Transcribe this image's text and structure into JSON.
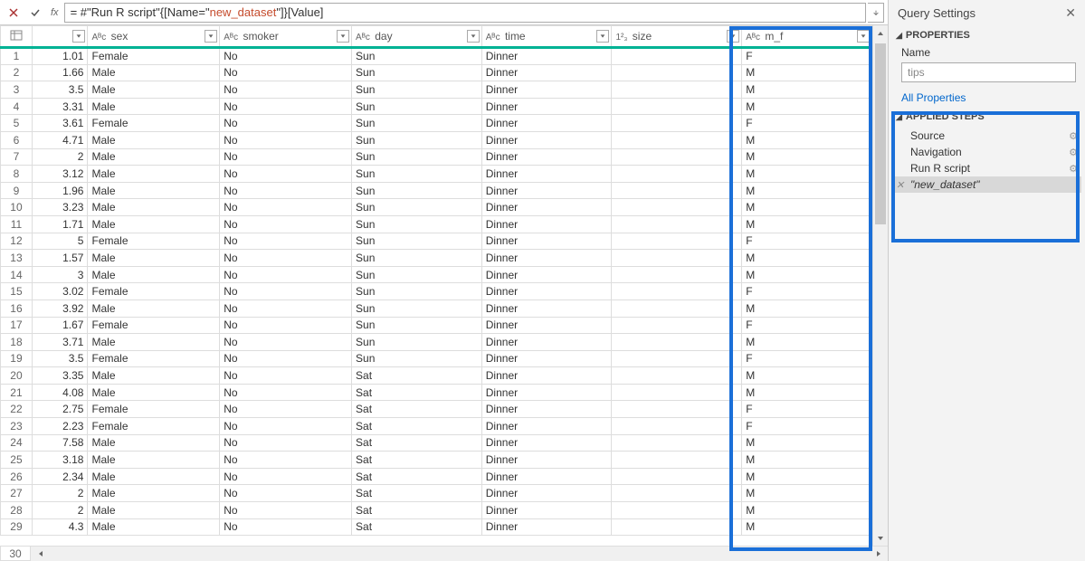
{
  "formula": {
    "prefix": "= #\"Run R script\"{[Name=\"",
    "highlight": "new_dataset",
    "suffix": "\"]}[Value]"
  },
  "columns": {
    "tip_type": "",
    "sex": "sex",
    "smoker": "smoker",
    "day": "day",
    "time": "time",
    "size": "size",
    "mf": "m_f"
  },
  "type_icons": {
    "abc": "Aᴮc",
    "num": "1²₃"
  },
  "rows": [
    {
      "n": "1",
      "tip": "1.01",
      "sex": "Female",
      "smoker": "No",
      "day": "Sun",
      "time": "Dinner",
      "size": "",
      "mf": "F"
    },
    {
      "n": "2",
      "tip": "1.66",
      "sex": "Male",
      "smoker": "No",
      "day": "Sun",
      "time": "Dinner",
      "size": "",
      "mf": "M"
    },
    {
      "n": "3",
      "tip": "3.5",
      "sex": "Male",
      "smoker": "No",
      "day": "Sun",
      "time": "Dinner",
      "size": "",
      "mf": "M"
    },
    {
      "n": "4",
      "tip": "3.31",
      "sex": "Male",
      "smoker": "No",
      "day": "Sun",
      "time": "Dinner",
      "size": "",
      "mf": "M"
    },
    {
      "n": "5",
      "tip": "3.61",
      "sex": "Female",
      "smoker": "No",
      "day": "Sun",
      "time": "Dinner",
      "size": "",
      "mf": "F"
    },
    {
      "n": "6",
      "tip": "4.71",
      "sex": "Male",
      "smoker": "No",
      "day": "Sun",
      "time": "Dinner",
      "size": "",
      "mf": "M"
    },
    {
      "n": "7",
      "tip": "2",
      "sex": "Male",
      "smoker": "No",
      "day": "Sun",
      "time": "Dinner",
      "size": "",
      "mf": "M"
    },
    {
      "n": "8",
      "tip": "3.12",
      "sex": "Male",
      "smoker": "No",
      "day": "Sun",
      "time": "Dinner",
      "size": "",
      "mf": "M"
    },
    {
      "n": "9",
      "tip": "1.96",
      "sex": "Male",
      "smoker": "No",
      "day": "Sun",
      "time": "Dinner",
      "size": "",
      "mf": "M"
    },
    {
      "n": "10",
      "tip": "3.23",
      "sex": "Male",
      "smoker": "No",
      "day": "Sun",
      "time": "Dinner",
      "size": "",
      "mf": "M"
    },
    {
      "n": "11",
      "tip": "1.71",
      "sex": "Male",
      "smoker": "No",
      "day": "Sun",
      "time": "Dinner",
      "size": "",
      "mf": "M"
    },
    {
      "n": "12",
      "tip": "5",
      "sex": "Female",
      "smoker": "No",
      "day": "Sun",
      "time": "Dinner",
      "size": "",
      "mf": "F"
    },
    {
      "n": "13",
      "tip": "1.57",
      "sex": "Male",
      "smoker": "No",
      "day": "Sun",
      "time": "Dinner",
      "size": "",
      "mf": "M"
    },
    {
      "n": "14",
      "tip": "3",
      "sex": "Male",
      "smoker": "No",
      "day": "Sun",
      "time": "Dinner",
      "size": "",
      "mf": "M"
    },
    {
      "n": "15",
      "tip": "3.02",
      "sex": "Female",
      "smoker": "No",
      "day": "Sun",
      "time": "Dinner",
      "size": "",
      "mf": "F"
    },
    {
      "n": "16",
      "tip": "3.92",
      "sex": "Male",
      "smoker": "No",
      "day": "Sun",
      "time": "Dinner",
      "size": "",
      "mf": "M"
    },
    {
      "n": "17",
      "tip": "1.67",
      "sex": "Female",
      "smoker": "No",
      "day": "Sun",
      "time": "Dinner",
      "size": "",
      "mf": "F"
    },
    {
      "n": "18",
      "tip": "3.71",
      "sex": "Male",
      "smoker": "No",
      "day": "Sun",
      "time": "Dinner",
      "size": "",
      "mf": "M"
    },
    {
      "n": "19",
      "tip": "3.5",
      "sex": "Female",
      "smoker": "No",
      "day": "Sun",
      "time": "Dinner",
      "size": "",
      "mf": "F"
    },
    {
      "n": "20",
      "tip": "3.35",
      "sex": "Male",
      "smoker": "No",
      "day": "Sat",
      "time": "Dinner",
      "size": "",
      "mf": "M"
    },
    {
      "n": "21",
      "tip": "4.08",
      "sex": "Male",
      "smoker": "No",
      "day": "Sat",
      "time": "Dinner",
      "size": "",
      "mf": "M"
    },
    {
      "n": "22",
      "tip": "2.75",
      "sex": "Female",
      "smoker": "No",
      "day": "Sat",
      "time": "Dinner",
      "size": "",
      "mf": "F"
    },
    {
      "n": "23",
      "tip": "2.23",
      "sex": "Female",
      "smoker": "No",
      "day": "Sat",
      "time": "Dinner",
      "size": "",
      "mf": "F"
    },
    {
      "n": "24",
      "tip": "7.58",
      "sex": "Male",
      "smoker": "No",
      "day": "Sat",
      "time": "Dinner",
      "size": "",
      "mf": "M"
    },
    {
      "n": "25",
      "tip": "3.18",
      "sex": "Male",
      "smoker": "No",
      "day": "Sat",
      "time": "Dinner",
      "size": "",
      "mf": "M"
    },
    {
      "n": "26",
      "tip": "2.34",
      "sex": "Male",
      "smoker": "No",
      "day": "Sat",
      "time": "Dinner",
      "size": "",
      "mf": "M"
    },
    {
      "n": "27",
      "tip": "2",
      "sex": "Male",
      "smoker": "No",
      "day": "Sat",
      "time": "Dinner",
      "size": "",
      "mf": "M"
    },
    {
      "n": "28",
      "tip": "2",
      "sex": "Male",
      "smoker": "No",
      "day": "Sat",
      "time": "Dinner",
      "size": "",
      "mf": "M"
    },
    {
      "n": "29",
      "tip": "4.3",
      "sex": "Male",
      "smoker": "No",
      "day": "Sat",
      "time": "Dinner",
      "size": "",
      "mf": "M"
    }
  ],
  "extra_row": "30",
  "panel": {
    "title": "Query Settings",
    "properties_label": "PROPERTIES",
    "name_label": "Name",
    "name_value": "tips",
    "all_props": "All Properties",
    "steps_label": "APPLIED STEPS",
    "steps": [
      {
        "label": "Source",
        "gear": true
      },
      {
        "label": "Navigation",
        "gear": true
      },
      {
        "label": "Run R script",
        "gear": true
      },
      {
        "label": "\"new_dataset\"",
        "gear": false,
        "selected": true
      }
    ]
  }
}
